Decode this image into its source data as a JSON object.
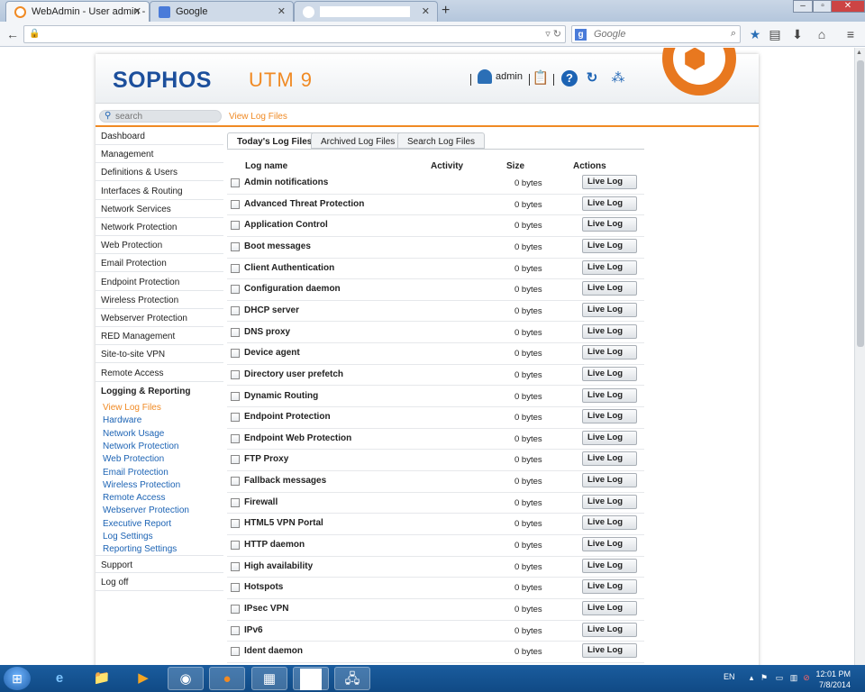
{
  "browser": {
    "tabs": [
      {
        "title": "WebAdmin - User admin - ..."
      },
      {
        "title": "Google"
      }
    ],
    "search_placeholder": "Google"
  },
  "header": {
    "logo": "SOPHOS",
    "product": "UTM 9",
    "user": "admin"
  },
  "search": {
    "placeholder": "search"
  },
  "breadcrumb": "View Log Files",
  "sidebar": {
    "items": [
      "Dashboard",
      "Management",
      "Definitions & Users",
      "Interfaces & Routing",
      "Network Services",
      "Network Protection",
      "Web Protection",
      "Email Protection",
      "Endpoint Protection",
      "Wireless Protection",
      "Webserver Protection",
      "RED Management",
      "Site-to-site VPN",
      "Remote Access"
    ],
    "open_section": "Logging & Reporting",
    "subitems": [
      "View Log Files",
      "Hardware",
      "Network Usage",
      "Network Protection",
      "Web Protection",
      "Email Protection",
      "Wireless Protection",
      "Remote Access",
      "Webserver Protection",
      "Executive Report",
      "Log Settings",
      "Reporting Settings"
    ],
    "after_items": [
      "Support",
      "Log off"
    ]
  },
  "content_tabs": [
    "Today's Log Files",
    "Archived Log Files",
    "Search Log Files"
  ],
  "table": {
    "headers": {
      "name": "Log name",
      "activity": "Activity",
      "size": "Size",
      "actions": "Actions"
    },
    "button_label": "Live Log",
    "rows": [
      {
        "name": "Admin notifications",
        "size": "0 bytes"
      },
      {
        "name": "Advanced Threat Protection",
        "size": "0 bytes"
      },
      {
        "name": "Application Control",
        "size": "0 bytes"
      },
      {
        "name": "Boot messages",
        "size": "0 bytes"
      },
      {
        "name": "Client Authentication",
        "size": "0 bytes"
      },
      {
        "name": "Configuration daemon",
        "size": "0 bytes"
      },
      {
        "name": "DHCP server",
        "size": "0 bytes"
      },
      {
        "name": "DNS proxy",
        "size": "0 bytes"
      },
      {
        "name": "Device agent",
        "size": "0 bytes"
      },
      {
        "name": "Directory user prefetch",
        "size": "0 bytes"
      },
      {
        "name": "Dynamic Routing",
        "size": "0 bytes"
      },
      {
        "name": "Endpoint Protection",
        "size": "0 bytes"
      },
      {
        "name": "Endpoint Web Protection",
        "size": "0 bytes"
      },
      {
        "name": "FTP Proxy",
        "size": "0 bytes"
      },
      {
        "name": "Fallback messages",
        "size": "0 bytes"
      },
      {
        "name": "Firewall",
        "size": "0 bytes"
      },
      {
        "name": "HTML5 VPN Portal",
        "size": "0 bytes"
      },
      {
        "name": "HTTP daemon",
        "size": "0 bytes"
      },
      {
        "name": "High availability",
        "size": "0 bytes"
      },
      {
        "name": "Hotspots",
        "size": "0 bytes"
      },
      {
        "name": "IPsec VPN",
        "size": "0 bytes"
      },
      {
        "name": "IPv6",
        "size": "0 bytes"
      },
      {
        "name": "Ident daemon",
        "size": "0 bytes"
      }
    ]
  },
  "taskbar": {
    "language": "EN",
    "time": "12:01 PM",
    "date": "7/8/2014"
  },
  "colors": {
    "brand_blue": "#1c4f9c",
    "accent_orange": "#f08a24",
    "link_blue": "#1c63b4",
    "taskbar": "#104a85"
  }
}
